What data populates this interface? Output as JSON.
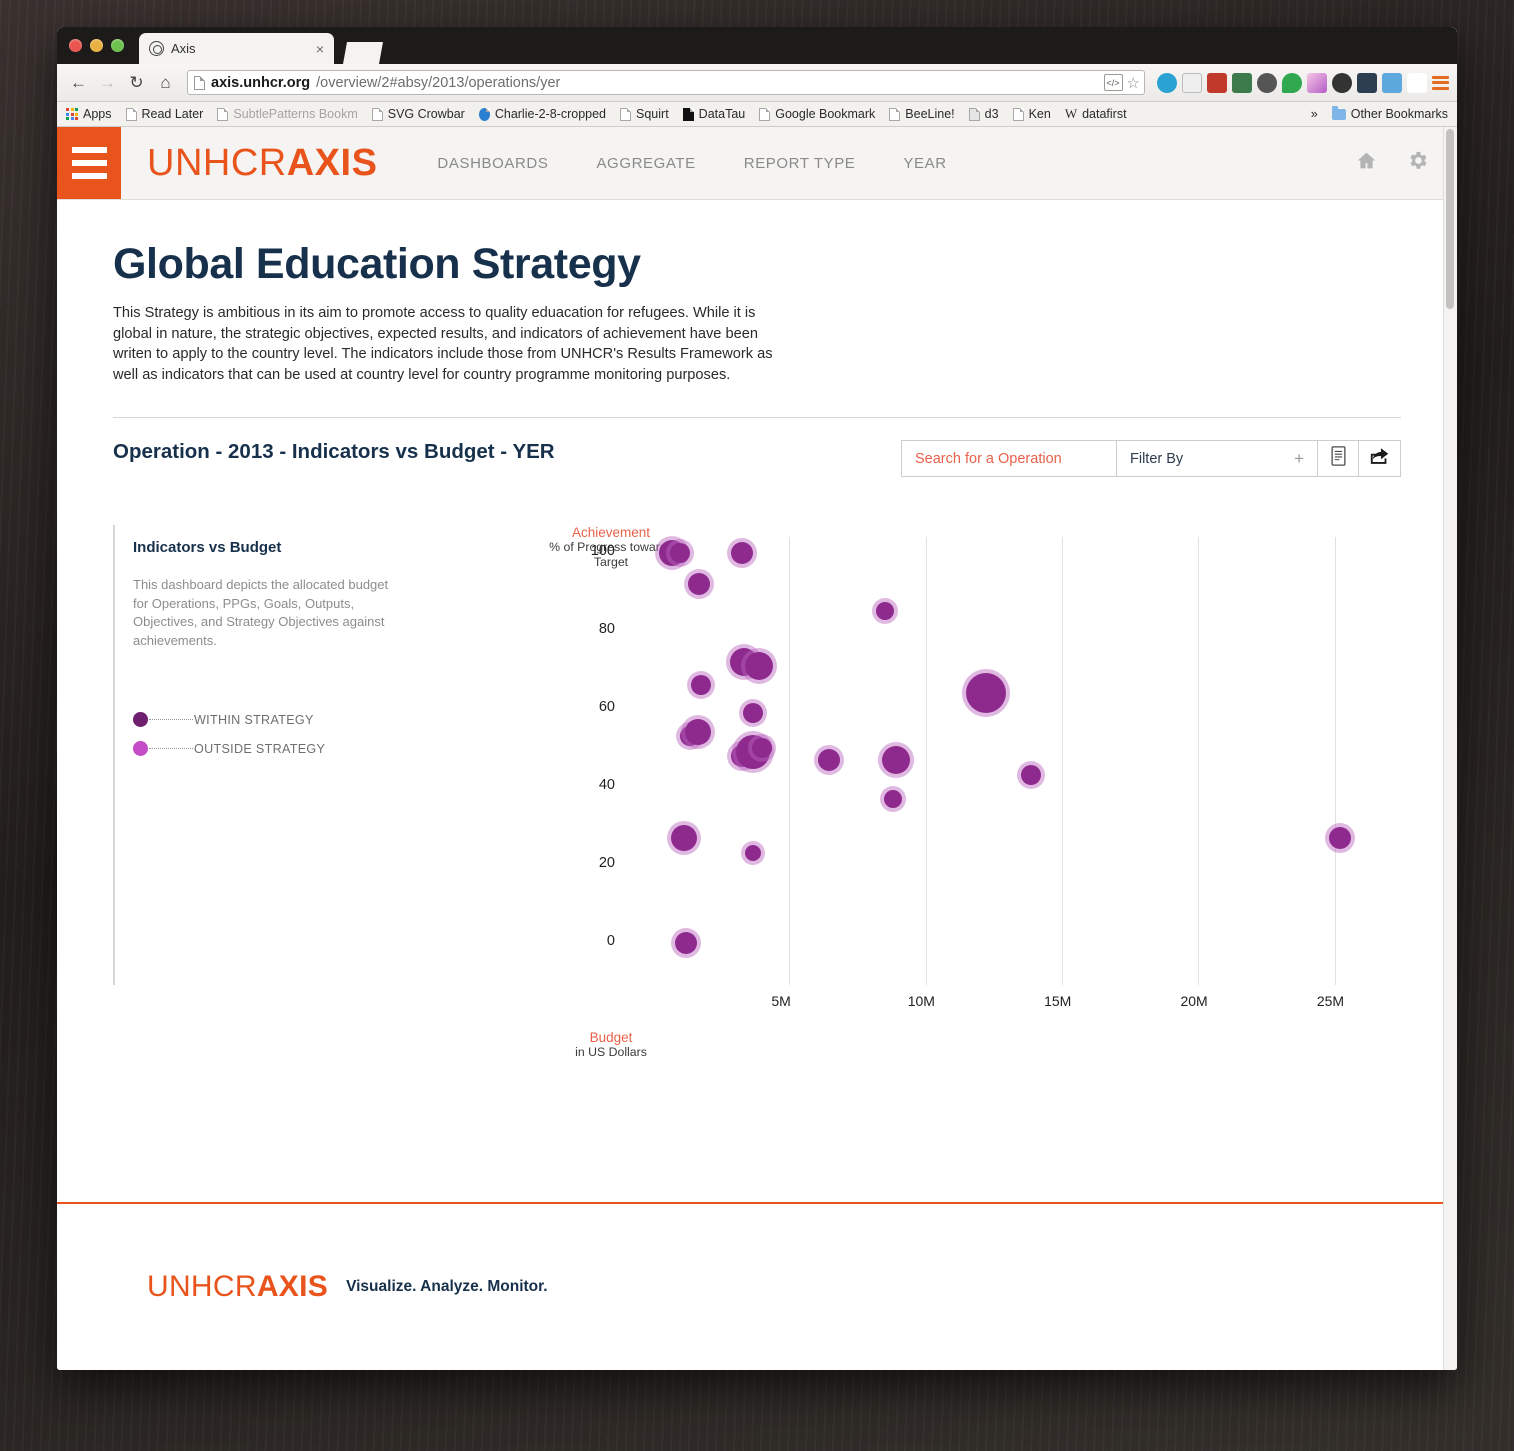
{
  "browser": {
    "tab": {
      "title": "Axis",
      "close_label": "×"
    },
    "url": {
      "host": "axis.unhcr.org",
      "path": "/overview/2#absy/2013/operations/yer"
    },
    "nav": {
      "back": "←",
      "forward": "→",
      "reload": "↻",
      "home": "⌂"
    },
    "bookmarks": [
      {
        "label": "Apps",
        "icon": "apps-grid-icon"
      },
      {
        "label": "Read Later",
        "icon": "page-icon"
      },
      {
        "label": "SubtlePatterns Bookm",
        "icon": "page-icon"
      },
      {
        "label": "SVG Crowbar",
        "icon": "page-icon"
      },
      {
        "label": "Charlie-2-8-cropped",
        "icon": "chrome-icon"
      },
      {
        "label": "Squirt",
        "icon": "page-icon"
      },
      {
        "label": "DataTau",
        "icon": "datatau-icon"
      },
      {
        "label": "Google Bookmark",
        "icon": "page-icon"
      },
      {
        "label": "BeeLine!",
        "icon": "page-icon"
      },
      {
        "label": "d3",
        "icon": "d3-icon"
      },
      {
        "label": "Ken",
        "icon": "page-icon"
      },
      {
        "label": "datafirst",
        "icon": "wikipedia-icon"
      }
    ],
    "overflow_label": "»",
    "other_bookmarks": "Other Bookmarks"
  },
  "header": {
    "logo_light": "UNHCR",
    "logo_bold": "AXIS",
    "nav": [
      {
        "label": "DASHBOARDS"
      },
      {
        "label": "AGGREGATE"
      },
      {
        "label": "REPORT TYPE"
      },
      {
        "label": "YEAR"
      }
    ],
    "icons": [
      "home-icon",
      "gear-icon"
    ]
  },
  "main": {
    "title": "Global Education Strategy",
    "description": "This Strategy is ambitious in its aim to promote access to quality eduacation for refugees. While it is global in nature, the strategic objectives, expected results, and indicators of achievement have been writen to apply to the country level. The indicators include those from UNHCR's Results Framework as well as indicators that can be used at country level for country programme monitoring purposes.",
    "section_title": "Operation - 2013 - Indicators vs Budget - YER",
    "search_placeholder": "Search for a Operation",
    "search_value": "",
    "filter_label": "Filter By",
    "filter_plus": "+",
    "report_button": "report-icon",
    "share_button": "share-icon"
  },
  "sidecard": {
    "title": "Indicators vs Budget",
    "body": "This dashboard depicts the allocated budget for Operations, PPGs, Goals, Outputs, Objectives, and Strategy Objectives against achievements.",
    "legend": [
      {
        "label": "WITHIN STRATEGY",
        "color": "#6e1f6e"
      },
      {
        "label": "OUTSIDE STRATEGY",
        "color": "#c44cc4"
      }
    ]
  },
  "footer": {
    "logo_light": "UNHCR",
    "logo_bold": "AXIS",
    "tagline": "Visualize. Analyze. Monitor."
  },
  "colors": {
    "brand_orange": "#e8541c",
    "navy": "#17304b",
    "bubble_fill": "#8e2a8e",
    "bubble_halo": "#ba64be",
    "accent_red": "#e8614a"
  },
  "chart_data": {
    "type": "scatter",
    "title": "Indicators vs Budget",
    "xlabel": "Budget",
    "xlabel_sub": "in US Dollars",
    "ylabel": "Achievement",
    "ylabel_sub": "% of Progress towards Target",
    "xticks": [
      "5M",
      "10M",
      "15M",
      "20M",
      "25M"
    ],
    "xtick_values": [
      5000000,
      10000000,
      15000000,
      20000000,
      25000000
    ],
    "yticks": [
      "0",
      "20",
      "40",
      "60",
      "80",
      "100"
    ],
    "ytick_values": [
      0,
      20,
      40,
      60,
      80,
      100
    ],
    "xlim": [
      0,
      27500000
    ],
    "ylim": [
      -3,
      104
    ],
    "grid": "vertical-only",
    "legend_position": "left-panel",
    "series": [
      {
        "name": "WITHIN STRATEGY",
        "color": "#8e2a8e",
        "points": [
          {
            "x": 700000,
            "y": 100,
            "r": 13
          },
          {
            "x": 1000000,
            "y": 100,
            "r": 10
          },
          {
            "x": 3250000,
            "y": 100,
            "r": 11
          },
          {
            "x": 1700000,
            "y": 92,
            "r": 11
          },
          {
            "x": 8500000,
            "y": 85,
            "r": 9
          },
          {
            "x": 3350000,
            "y": 72,
            "r": 14
          },
          {
            "x": 3900000,
            "y": 71,
            "r": 14
          },
          {
            "x": 1750000,
            "y": 66,
            "r": 10
          },
          {
            "x": 3650000,
            "y": 59,
            "r": 10
          },
          {
            "x": 12200000,
            "y": 64,
            "r": 20
          },
          {
            "x": 1350000,
            "y": 53,
            "r": 10
          },
          {
            "x": 1650000,
            "y": 54,
            "r": 13
          },
          {
            "x": 3250000,
            "y": 48,
            "r": 11
          },
          {
            "x": 3650000,
            "y": 49,
            "r": 17
          },
          {
            "x": 4000000,
            "y": 50,
            "r": 10
          },
          {
            "x": 6450000,
            "y": 47,
            "r": 11
          },
          {
            "x": 8900000,
            "y": 47,
            "r": 14
          },
          {
            "x": 13850000,
            "y": 43,
            "r": 10
          },
          {
            "x": 8800000,
            "y": 37,
            "r": 9
          },
          {
            "x": 1150000,
            "y": 27,
            "r": 13
          },
          {
            "x": 3650000,
            "y": 23,
            "r": 8
          },
          {
            "x": 25200000,
            "y": 27,
            "r": 11
          },
          {
            "x": 1200000,
            "y": 0,
            "r": 11
          }
        ]
      }
    ]
  }
}
